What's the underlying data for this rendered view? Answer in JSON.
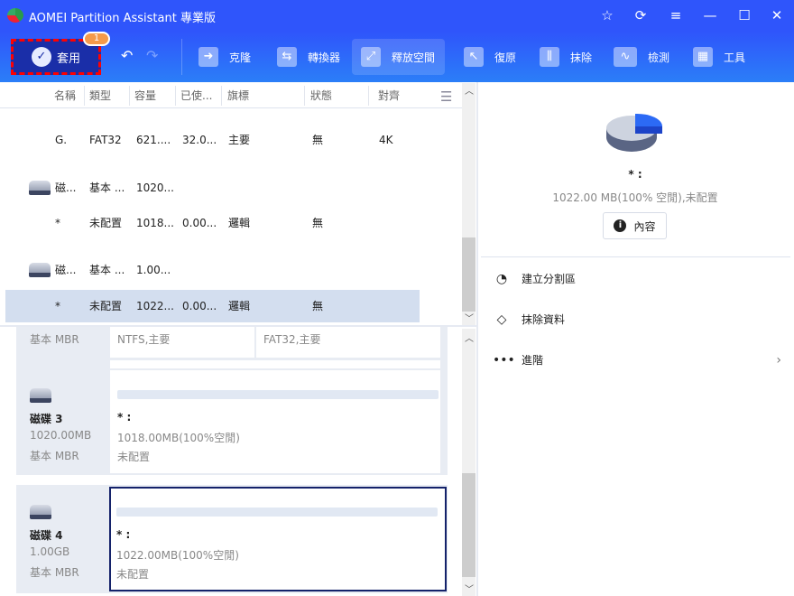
{
  "window": {
    "title": "AOMEI Partition Assistant 專業版"
  },
  "toolbar": {
    "apply": "套用",
    "badge": "1",
    "items": [
      {
        "label": "克隆",
        "icon": "clone-icon"
      },
      {
        "label": "轉換器",
        "icon": "converter-icon"
      },
      {
        "label": "釋放空間",
        "icon": "free-space-icon"
      },
      {
        "label": "復原",
        "icon": "recovery-icon"
      },
      {
        "label": "抹除",
        "icon": "wipe-icon"
      },
      {
        "label": "檢測",
        "icon": "test-icon"
      },
      {
        "label": "工具",
        "icon": "tools-icon"
      }
    ]
  },
  "table": {
    "columns": [
      "名稱",
      "類型",
      "容量",
      "已使...",
      "旗標",
      "狀態",
      "對齊"
    ],
    "rows": [
      {
        "name": "G.",
        "type": "FAT32",
        "cap": "621....",
        "used": "32.0...",
        "flag": "主要",
        "status": "無",
        "align": "4K"
      },
      {
        "name": "磁...",
        "type": "基本 ...",
        "cap": "1020...",
        "used": "",
        "flag": "",
        "status": "",
        "align": "",
        "disk": true
      },
      {
        "name": "*",
        "type": "未配置",
        "cap": "1018...",
        "used": "0.00...",
        "flag": "邏輯",
        "status": "無",
        "align": ""
      },
      {
        "name": "磁...",
        "type": "基本 ...",
        "cap": "1.00...",
        "used": "",
        "flag": "",
        "status": "",
        "align": "",
        "disk": true
      },
      {
        "name": "*",
        "type": "未配置",
        "cap": "1022...",
        "used": "0.00...",
        "flag": "邏輯",
        "status": "無",
        "align": "",
        "selected": true
      }
    ]
  },
  "disks": {
    "top": {
      "type": "基本 MBR",
      "p1": "NTFS,主要",
      "p2": "FAT32,主要"
    },
    "list": [
      {
        "name": "磁碟 3",
        "size": "1020.00MB",
        "type": "基本 MBR",
        "part_name": "* :",
        "part_size": "1018.00MB(100%空閒)",
        "part_type": "未配置"
      },
      {
        "name": "磁碟 4",
        "size": "1.00GB",
        "type": "基本 MBR",
        "part_name": "* :",
        "part_size": "1022.00MB(100%空閒)",
        "part_type": "未配置"
      }
    ]
  },
  "panel": {
    "name": "* :",
    "info": "1022.00 MB(100% 空閒),未配置",
    "props": "內容",
    "actions": [
      "建立分割區",
      "抹除資料",
      "進階"
    ]
  }
}
